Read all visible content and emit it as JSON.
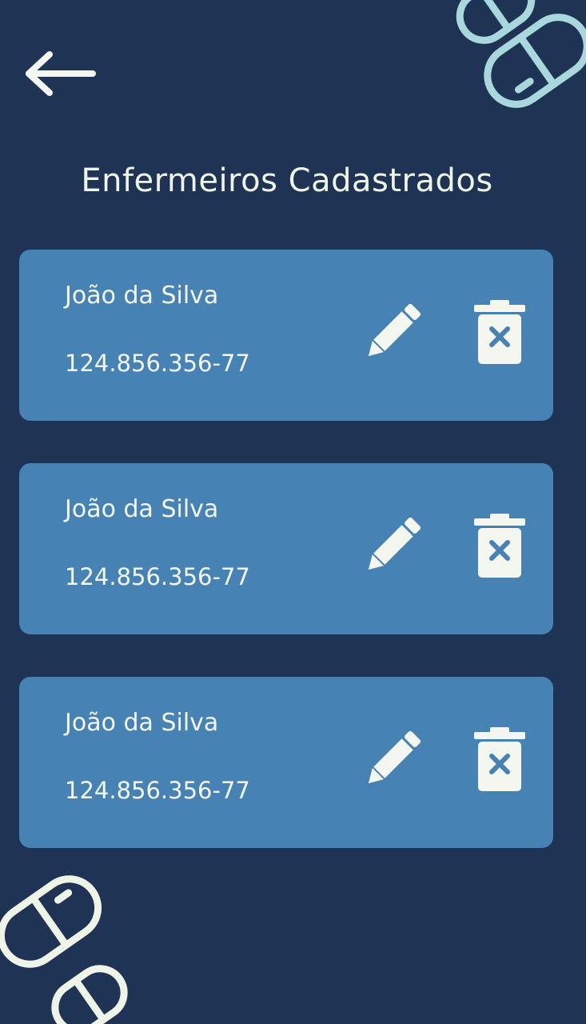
{
  "header": {
    "back_icon": "arrow-left-icon",
    "title": "Enfermeiros Cadastrados"
  },
  "nurses": [
    {
      "name": "João da Silva",
      "cpf": "124.856.356-77"
    },
    {
      "name": "João da Silva",
      "cpf": "124.856.356-77"
    },
    {
      "name": "João da Silva",
      "cpf": "124.856.356-77"
    }
  ],
  "icons": {
    "edit": "pencil-icon",
    "delete": "trash-x-icon",
    "decoration": "pill-capsule-icon"
  },
  "colors": {
    "background": "#1f3454",
    "card": "#4682b4",
    "text": "#eef4e6",
    "decoration_top": "#a8d8dc",
    "decoration_bottom": "#eef4e6"
  }
}
